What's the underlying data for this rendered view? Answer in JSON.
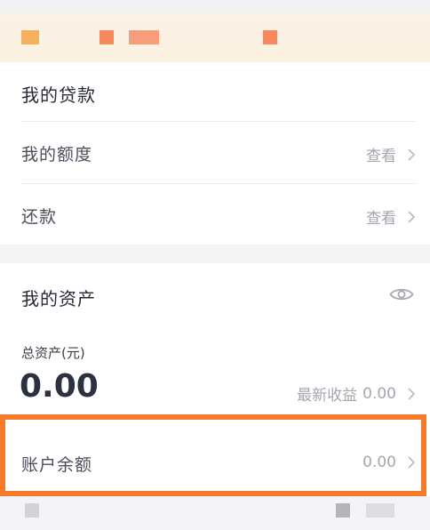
{
  "colors": {
    "accent_orange": "#f47a2c",
    "page_bg": "#f4f4f6",
    "banner_bg": "#fbf2e4",
    "muted_text": "#a4a7ae"
  },
  "loans": {
    "title": "我的贷款",
    "items": [
      {
        "label": "我的额度",
        "action": "查看"
      },
      {
        "label": "还款",
        "action": "查看"
      }
    ]
  },
  "assets": {
    "title": "我的资产",
    "visibility_icon": "eye-icon",
    "total_label": "总资产(元)",
    "total_value": "0.00",
    "recent_income_label": "最新收益",
    "recent_income_value": "0.00",
    "balance_label": "账户余额",
    "balance_value": "0.00"
  }
}
